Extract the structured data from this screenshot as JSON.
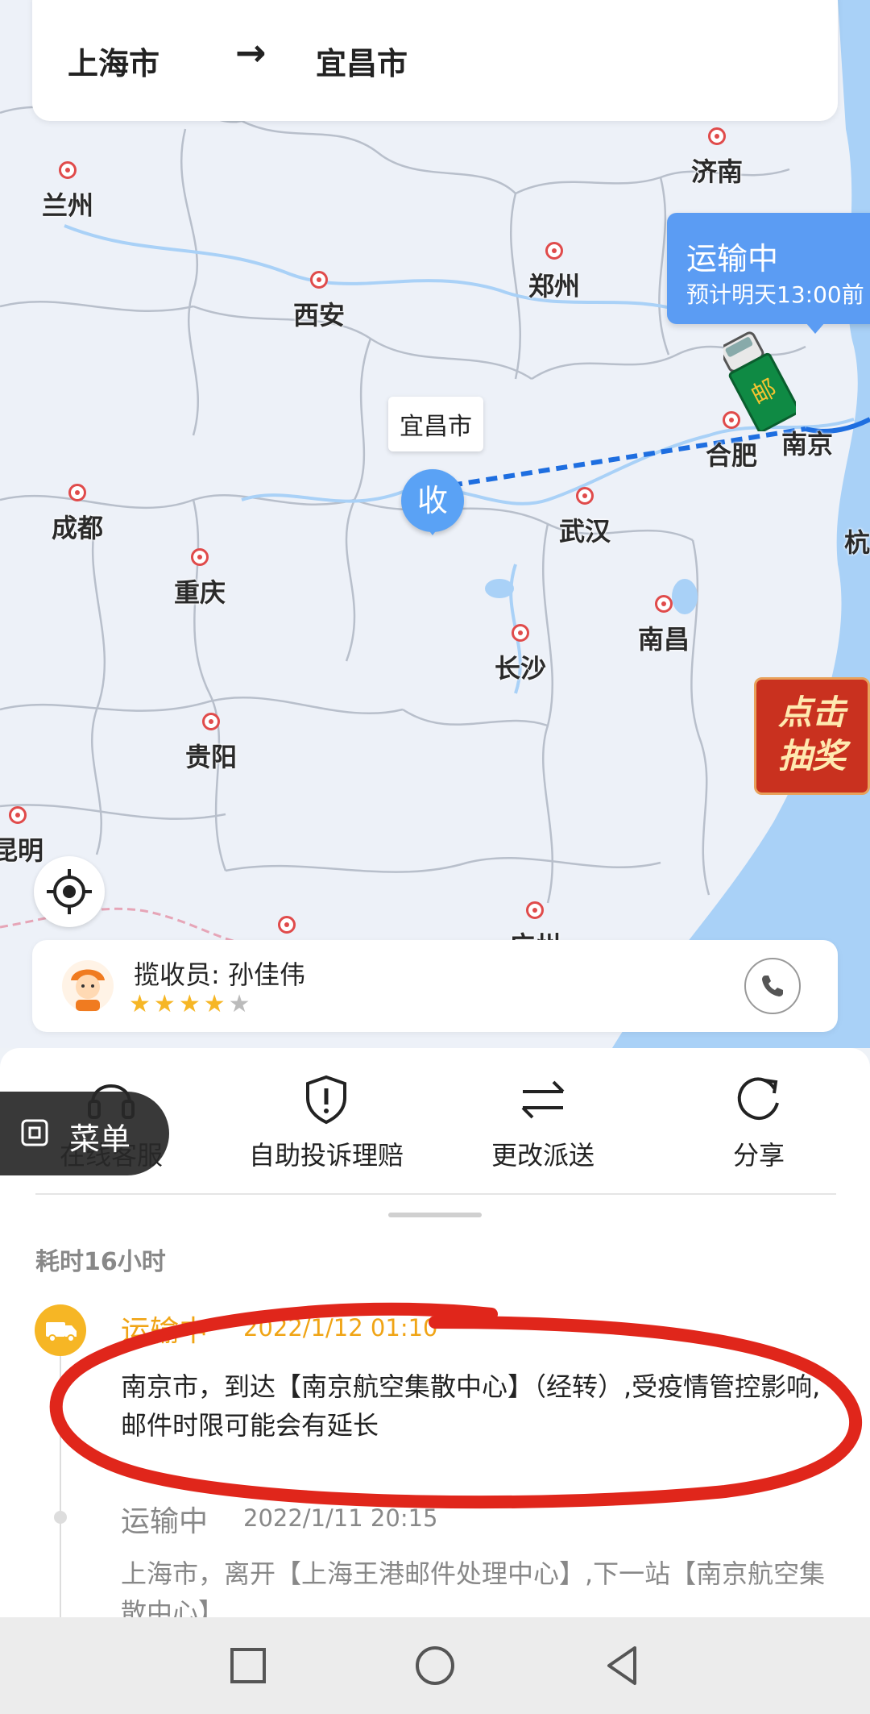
{
  "route": {
    "from": "上海市",
    "arrow": "→",
    "to": "宜昌市"
  },
  "map": {
    "cities": [
      {
        "id": "jinan",
        "name": "济南"
      },
      {
        "id": "lanzhou",
        "name": "兰州"
      },
      {
        "id": "zhengzhou",
        "name": "郑州"
      },
      {
        "id": "xian",
        "name": "西安"
      },
      {
        "id": "hefei",
        "name": "合肥"
      },
      {
        "id": "nanjing",
        "name": "南京"
      },
      {
        "id": "chengdu",
        "name": "成都"
      },
      {
        "id": "wuhan",
        "name": "武汉"
      },
      {
        "id": "chongqing",
        "name": "重庆"
      },
      {
        "id": "nanchang",
        "name": "南昌"
      },
      {
        "id": "changsha",
        "name": "长沙"
      },
      {
        "id": "guiyang",
        "name": "贵阳"
      },
      {
        "id": "kunming",
        "name": "昆明"
      },
      {
        "id": "guangzhou",
        "name": "广州"
      },
      {
        "id": "hangzhou",
        "name": "杭"
      }
    ],
    "destination_label": "宜昌市",
    "receive_pin": "收",
    "status_bubble": {
      "status": "运输中",
      "eta": "预计明天13:00前"
    },
    "lottery": {
      "line1": "点击",
      "line2": "抽奖"
    }
  },
  "courier": {
    "label": "揽收员: 孙佳伟",
    "rating": 4,
    "max_rating": 5
  },
  "actions": [
    {
      "id": "service",
      "label": "在线客服",
      "icon": "headset-icon"
    },
    {
      "id": "complaint",
      "label": "自助投诉理赔",
      "icon": "shield-alert-icon"
    },
    {
      "id": "redirect",
      "label": "更改派送",
      "icon": "swap-arrows-icon"
    },
    {
      "id": "share",
      "label": "分享",
      "icon": "share-refresh-icon"
    }
  ],
  "menu": {
    "label": "菜单"
  },
  "tracking": {
    "duration": "耗时16小时",
    "events": [
      {
        "status": "运输中",
        "time": "2022/1/12 01:10",
        "desc": "南京市，到达【南京航空集散中心】（经转）,受疫情管控影响,邮件时限可能会有延长"
      },
      {
        "status": "运输中",
        "time": "2022/1/11 20:15",
        "desc": "上海市，离开【上海王港邮件处理中心】,下一站【南京航空集散中心】"
      }
    ]
  },
  "colors": {
    "accent_blue": "#5b9cf3",
    "status_orange": "#f0a415",
    "annotation_red": "#e0261b"
  }
}
